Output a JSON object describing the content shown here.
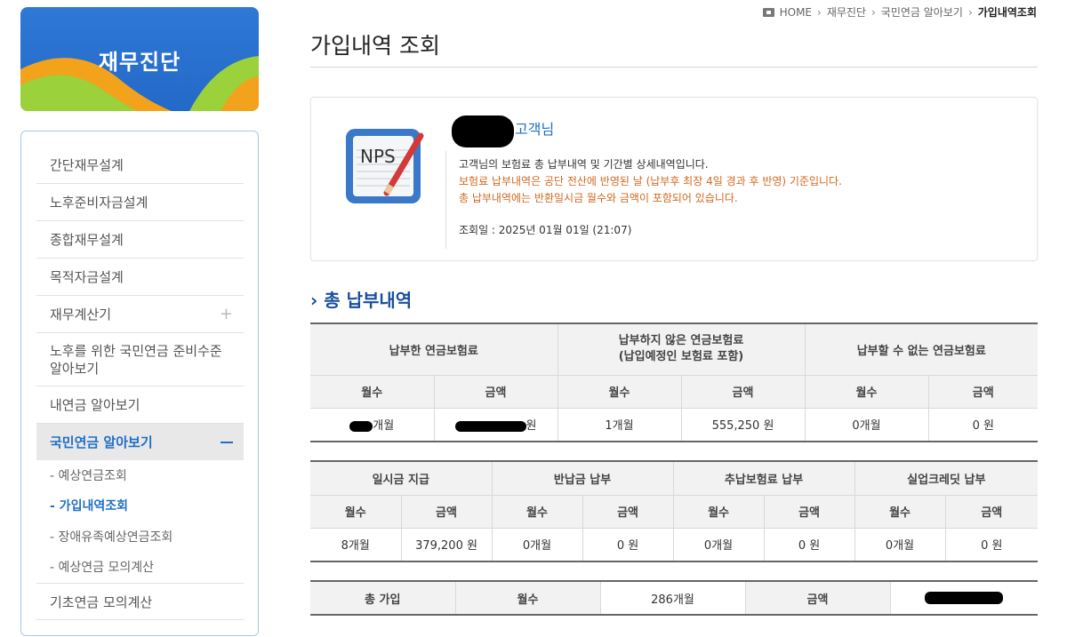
{
  "sidebar": {
    "banner_title": "재무진단",
    "items": [
      {
        "label": "간단재무설계"
      },
      {
        "label": "노후준비자금설계"
      },
      {
        "label": "종합재무설계"
      },
      {
        "label": "목적자금설계"
      },
      {
        "label": "재무계산기",
        "expand": "+"
      },
      {
        "label": "노후를 위한 국민연금 준비수준 알아보기"
      },
      {
        "label": "내연금 알아보기"
      },
      {
        "label": "국민연금 알아보기"
      },
      {
        "label": "기초연금 모의계산"
      }
    ],
    "subitems": [
      {
        "label": "- 예상연금조회"
      },
      {
        "label": "- 가입내역조회"
      },
      {
        "label": "- 장애유족예상연금조회"
      },
      {
        "label": "- 예상연금 모의계산"
      }
    ]
  },
  "breadcrumb": {
    "home": "HOME",
    "b1": "재무진단",
    "b2": "국민연금 알아보기",
    "current": "가입내역조회"
  },
  "page_title": "가입내역 조회",
  "info": {
    "icon_text": "NPS",
    "customer_suffix": "고객님",
    "desc1": "고객님의 보험료 총 납부내역 및 기간별 상세내역입니다.",
    "desc2": "보험료 납부내역은 공단 전산에 반영된 날 (납부후 최장 4일 경과 후 반영) 기준입니다.",
    "desc3": "총 납부내역에는 반환일시금 월수와 금액이 포함되어 있습니다.",
    "query_date": "조회일 : 2025년 01월 01일 (21:07)"
  },
  "section_title": "총 납부내역",
  "table1": {
    "groups": [
      "납부한 연금보험료",
      "납부하지 않은 연금보험료\n(납입예정인 보험료 포함)",
      "납부할 수 없는 연금보험료"
    ],
    "sub": [
      "월수",
      "금액",
      "월수",
      "금액",
      "월수",
      "금액"
    ],
    "row": [
      "개월",
      "원",
      "1개월",
      "555,250 원",
      "0개월",
      "0 원"
    ]
  },
  "table2": {
    "groups": [
      "일시금 지급",
      "반납금 납부",
      "추납보험료 납부",
      "실업크레딧 납부"
    ],
    "sub": [
      "월수",
      "금액",
      "월수",
      "금액",
      "월수",
      "금액",
      "월수",
      "금액"
    ],
    "row": [
      "8개월",
      "379,200 원",
      "0개월",
      "0 원",
      "0개월",
      "0 원",
      "0개월",
      "0 원"
    ]
  },
  "table3": {
    "c1": "총 가입",
    "c2": "월수",
    "c3": "286개월",
    "c4": "금액"
  }
}
